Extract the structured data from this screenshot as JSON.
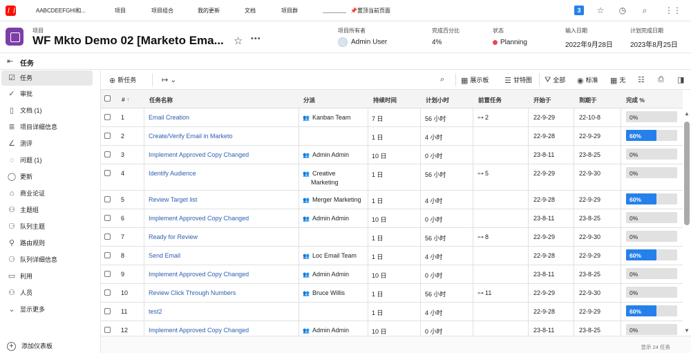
{
  "topnav": {
    "app_name": "AABCDEEFGHI和...",
    "items": [
      "项目",
      "项目组合",
      "我的更新",
      "文档",
      "项目群"
    ],
    "pin_label": "置顶当前页面",
    "badge_count": "3"
  },
  "header": {
    "type_label": "项目",
    "title": "WF Mkto Demo 02 [Marketo Ema...",
    "owner_label": "项目所有者",
    "owner_value": "Admin User",
    "percent_label": "完成百分比",
    "percent_value": "4%",
    "status_label": "状态",
    "status_value": "Planning",
    "status_color": "#e34850",
    "entry_label": "输入日期",
    "entry_value": "2022年9月28日",
    "planned_label": "计划完成日期",
    "planned_value": "2023年8月25日"
  },
  "section": {
    "title": "任务"
  },
  "sidebar": {
    "items": [
      {
        "label": "任务",
        "icon": "task-icon"
      },
      {
        "label": "审批",
        "icon": "approval-icon"
      },
      {
        "label": "文档 (1)",
        "icon": "document-icon"
      },
      {
        "label": "项目详细信息",
        "icon": "details-icon"
      },
      {
        "label": "测评",
        "icon": "chart-icon"
      },
      {
        "label": "问题 (1)",
        "icon": "issue-icon"
      },
      {
        "label": "更新",
        "icon": "comment-icon"
      },
      {
        "label": "商业论证",
        "icon": "business-case-icon"
      },
      {
        "label": "主题组",
        "icon": "team-icon"
      },
      {
        "label": "队列主题",
        "icon": "queue-icon"
      },
      {
        "label": "路由规则",
        "icon": "routing-icon"
      },
      {
        "label": "队列详细信息",
        "icon": "queue-details-icon"
      },
      {
        "label": "利用",
        "icon": "utilization-icon"
      },
      {
        "label": "人员",
        "icon": "people-icon"
      },
      {
        "label": "显示更多",
        "icon": "chevron-down-icon"
      }
    ],
    "add_panel": "添加仪表板"
  },
  "toolbar": {
    "new_task": "新任务",
    "board_view": "展示板",
    "gantt": "甘特图",
    "filter_all": "全部",
    "view_standard": "标准",
    "group_none": "无"
  },
  "table": {
    "headers": [
      "#",
      "任务名称",
      "分派",
      "持续时间",
      "计划小时",
      "前置任务",
      "开始于",
      "到期于",
      "完成 %"
    ],
    "rows": [
      {
        "num": "1",
        "name": "Email Creation",
        "assign": "Kanban Team",
        "assign2": "",
        "dur": "7 日",
        "hours": "56 小时",
        "pred": "2",
        "start": "22-9-29",
        "due": "22-10-8",
        "pct": "0%",
        "pct_value": 0
      },
      {
        "num": "2",
        "name": "Create/Verify Email in Marketo",
        "assign": "",
        "assign2": "",
        "dur": "1 日",
        "hours": "4 小时",
        "pred": "",
        "start": "22-9-28",
        "due": "22-9-29",
        "pct": "60%",
        "pct_value": 60
      },
      {
        "num": "3",
        "name": "Implement Approved Copy Changed",
        "assign": "Admin Admin",
        "assign2": "",
        "dur": "10 日",
        "hours": "0 小时",
        "pred": "",
        "start": "23-8-11",
        "due": "23-8-25",
        "pct": "0%",
        "pct_value": 0
      },
      {
        "num": "4",
        "name": "Identify Audience",
        "assign": "Creative",
        "assign2": "Marketing",
        "dur": "1 日",
        "hours": "56 小时",
        "pred": "5",
        "start": "22-9-29",
        "due": "22-9-30",
        "pct": "0%",
        "pct_value": 0
      },
      {
        "num": "5",
        "name": "Review Target list",
        "assign": "Merger Marketing",
        "assign2": "",
        "dur": "1 日",
        "hours": "4 小时",
        "pred": "",
        "start": "22-9-28",
        "due": "22-9-29",
        "pct": "60%",
        "pct_value": 60
      },
      {
        "num": "6",
        "name": "Implement Approved Copy Changed",
        "assign": "Admin Admin",
        "assign2": "",
        "dur": "10 日",
        "hours": "0 小时",
        "pred": "",
        "start": "23-8-11",
        "due": "23-8-25",
        "pct": "0%",
        "pct_value": 0
      },
      {
        "num": "7",
        "name": "Ready for Review",
        "assign": "",
        "assign2": "",
        "dur": "1 日",
        "hours": "56 小时",
        "pred": "8",
        "start": "22-9-29",
        "due": "22-9-30",
        "pct": "0%",
        "pct_value": 0
      },
      {
        "num": "8",
        "name": "Send Email",
        "assign": "Loc Email Team",
        "assign2": "",
        "dur": "1 日",
        "hours": "4 小时",
        "pred": "",
        "start": "22-9-28",
        "due": "22-9-29",
        "pct": "60%",
        "pct_value": 60
      },
      {
        "num": "9",
        "name": "Implement Approved Copy Changed",
        "assign": "Admin Admin",
        "assign2": "",
        "dur": "10 日",
        "hours": "0 小时",
        "pred": "",
        "start": "23-8-11",
        "due": "23-8-25",
        "pct": "0%",
        "pct_value": 0
      },
      {
        "num": "10",
        "name": "Review Click Through Numbers",
        "assign": "Bruce Willis",
        "assign2": "",
        "dur": "1 日",
        "hours": "56 小时",
        "pred": "11",
        "start": "22-9-29",
        "due": "22-9-30",
        "pct": "0%",
        "pct_value": 0
      },
      {
        "num": "11",
        "name": "test2",
        "assign": "",
        "assign2": "",
        "dur": "1 日",
        "hours": "4 小时",
        "pred": "",
        "start": "22-9-28",
        "due": "22-9-29",
        "pct": "60%",
        "pct_value": 60
      },
      {
        "num": "12",
        "name": "Implement Approved Copy Changed",
        "assign": "Admin Admin",
        "assign2": "",
        "dur": "10 日",
        "hours": "0 小时",
        "pred": "",
        "start": "23-8-11",
        "due": "23-8-25",
        "pct": "0%",
        "pct_value": 0
      }
    ],
    "footer": "显示 24 任务"
  }
}
